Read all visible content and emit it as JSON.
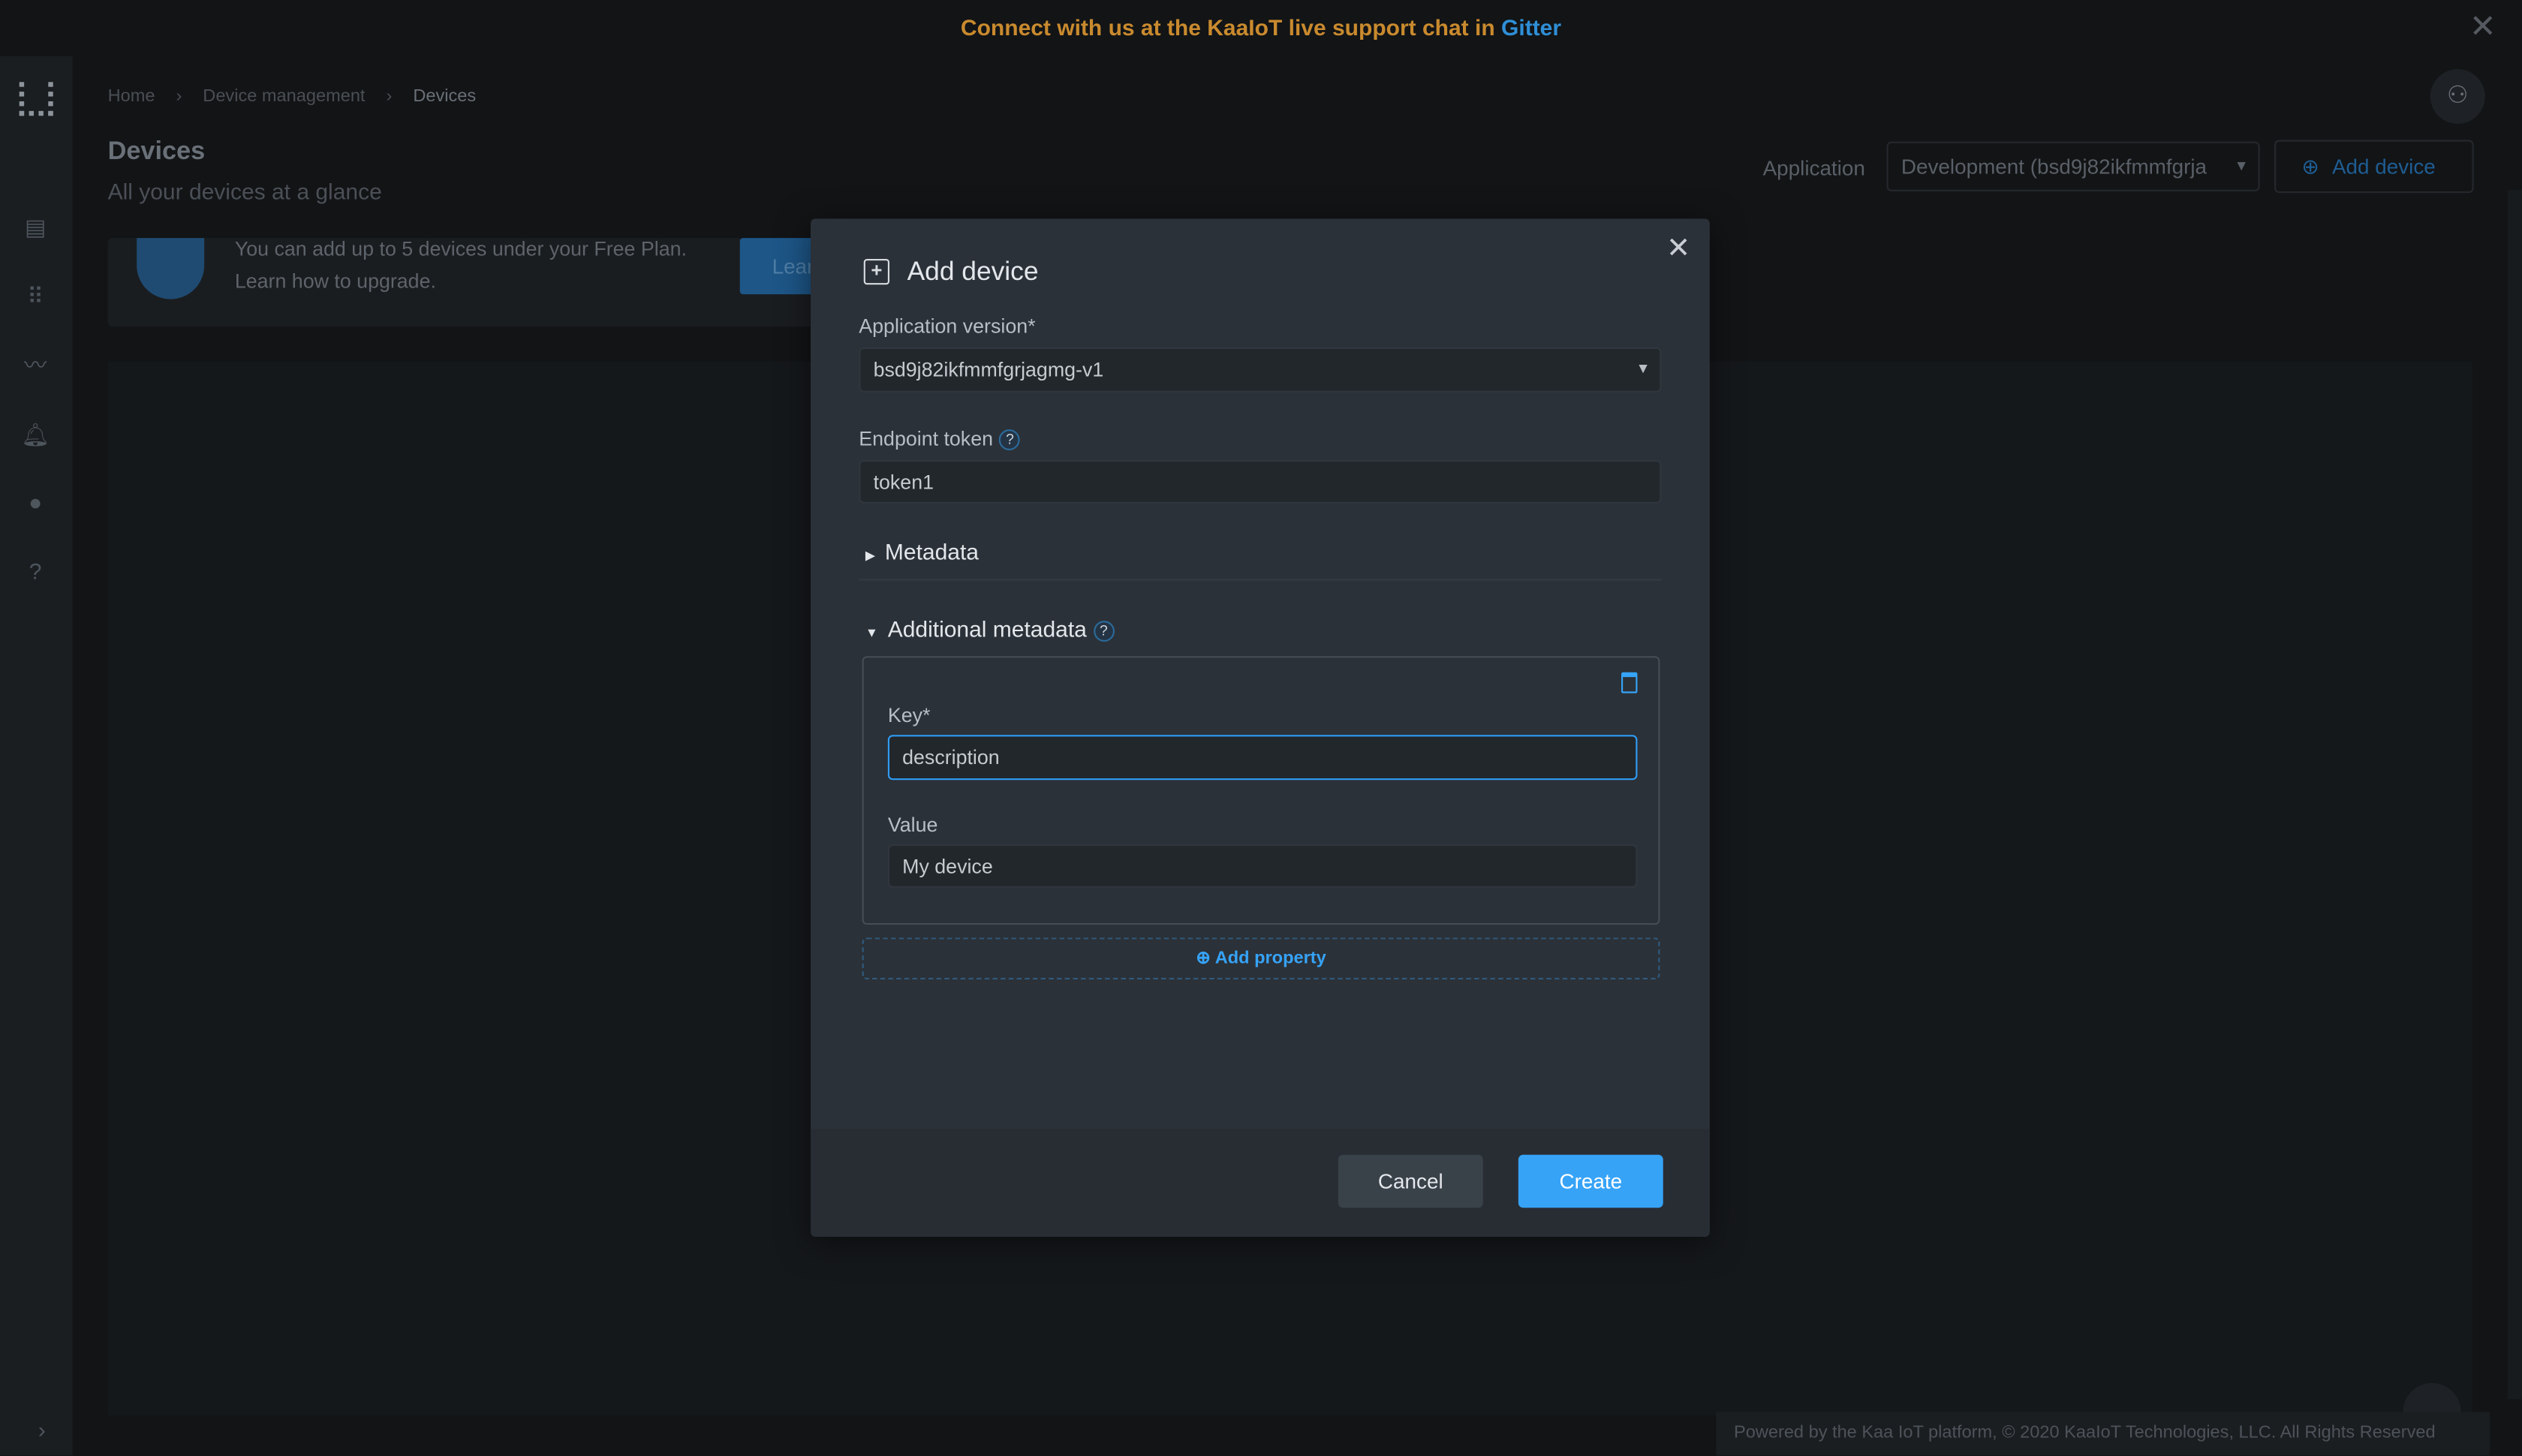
{
  "banner": {
    "text": "Connect with us at the KaaIoT live support chat in",
    "link": "Gitter"
  },
  "breadcrumb": [
    "Home",
    "Device management",
    "Devices"
  ],
  "page": {
    "title": "Devices",
    "subtitle": "All your devices at a glance"
  },
  "plan_card": {
    "line1": "You can add up to 5 devices under your Free Plan.",
    "line2": "Learn how to upgrade.",
    "button": "Lear"
  },
  "header": {
    "application_label": "Application",
    "application_value": "Development (bsd9j82ikfmmfgrja",
    "add_device": "Add device"
  },
  "footer": {
    "text": "Powered by the Kaa IoT platform, © 2020 KaaIoT Technologies, LLC. All Rights Reserved"
  },
  "dialog": {
    "title": "Add device",
    "app_version_label": "Application version*",
    "app_version_value": "bsd9j82ikfmmfgrjagmg-v1",
    "endpoint_token_label": "Endpoint token",
    "endpoint_token_value": "token1",
    "metadata_label": "Metadata",
    "additional_metadata_label": "Additional metadata",
    "key_label": "Key*",
    "key_value": "description",
    "value_label": "Value",
    "value_value": "My device",
    "add_property": "Add property",
    "cancel": "Cancel",
    "create": "Create"
  },
  "colors": {
    "accent": "#36a3f7",
    "banner": "#c98a2e",
    "link": "#2f8fd6",
    "modal_bg": "#2b3138"
  }
}
